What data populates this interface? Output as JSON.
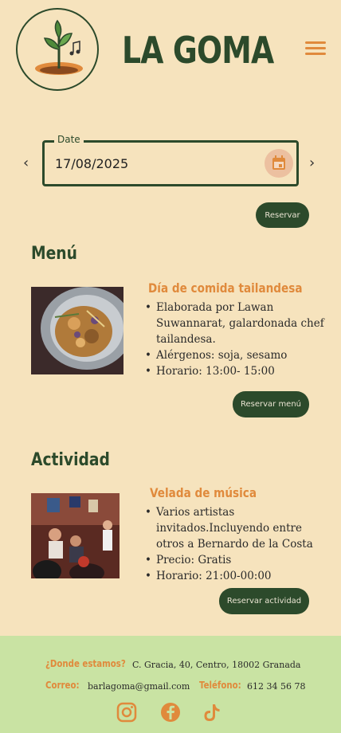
{
  "header": {
    "brand": "LA GOMA",
    "logo_icon": "plant-music-note-logo",
    "menu_icon": "hamburger-menu-icon"
  },
  "date_picker": {
    "legend": "Date",
    "value": "17/08/2025",
    "prev_icon": "chevron-left-icon",
    "next_icon": "chevron-right-icon",
    "calendar_icon": "calendar-icon"
  },
  "reserve_button": "Reservar",
  "menu_section": {
    "title": "Menú",
    "card_title": "Día de comida tailandesa",
    "bullets": [
      "Elaborada por Lawan Suwannarat, galardonada chef tailandesa.",
      "Alérgenos: soja, sesamo",
      "Horario: 13:00- 15:00"
    ],
    "button": "Reservar menú"
  },
  "activity_section": {
    "title": "Actividad",
    "card_title": "Velada de música",
    "bullets": [
      "Varios artistas invitados.Incluyendo entre otros a Bernardo de la Costa",
      "Precio: Gratis",
      "Horario: 21:00-00:00"
    ],
    "button": "Reservar actividad"
  },
  "footer": {
    "where_label": "¿Donde estamos?",
    "address": "C. Gracia, 40, Centro, 18002 Granada",
    "mail_label": "Correo:",
    "mail": "barlagoma@gmail.com",
    "phone_label": "Teléfono:",
    "phone": "612 34 56 78",
    "social": [
      "instagram-icon",
      "facebook-icon",
      "tiktok-icon"
    ]
  },
  "colors": {
    "background": "#f6e3bd",
    "primary_green": "#2c4a2b",
    "accent_orange": "#e08a3c",
    "footer_green": "#c9e3a3"
  }
}
